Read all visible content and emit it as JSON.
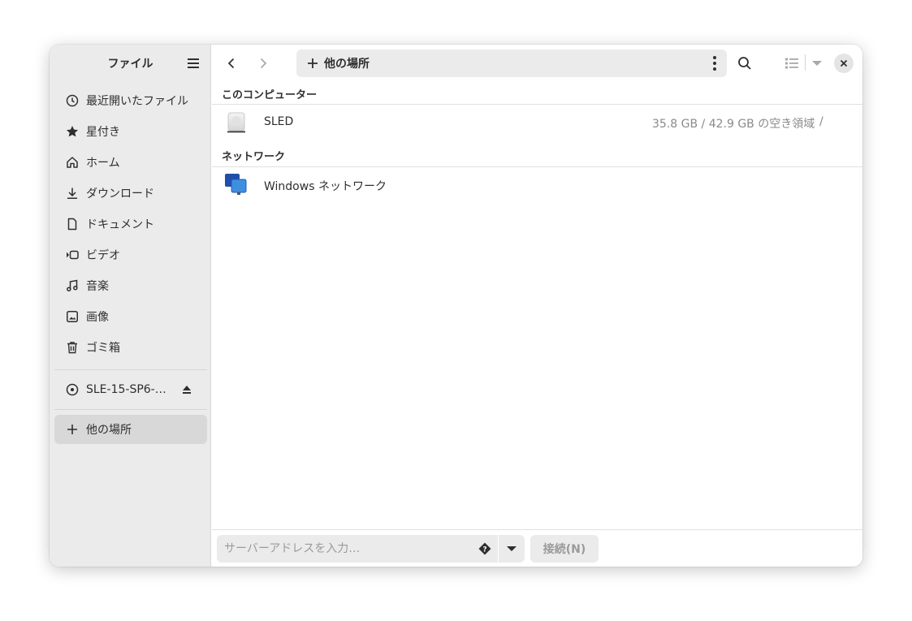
{
  "sidebar": {
    "title": "ファイル",
    "items": [
      {
        "label": "最近開いたファイル",
        "icon": "clock-icon"
      },
      {
        "label": "星付き",
        "icon": "star-icon"
      },
      {
        "label": "ホーム",
        "icon": "home-icon"
      },
      {
        "label": "ダウンロード",
        "icon": "download-icon"
      },
      {
        "label": "ドキュメント",
        "icon": "document-icon"
      },
      {
        "label": "ビデオ",
        "icon": "video-icon"
      },
      {
        "label": "音楽",
        "icon": "music-icon"
      },
      {
        "label": "画像",
        "icon": "image-icon"
      },
      {
        "label": "ゴミ箱",
        "icon": "trash-icon"
      }
    ],
    "device": {
      "label": "SLE-15-SP6-…",
      "icon": "disc-icon"
    },
    "other_locations": {
      "label": "他の場所",
      "icon": "plus-icon"
    }
  },
  "header": {
    "path_label": "他の場所"
  },
  "content": {
    "sections": [
      {
        "title": "このコンピューター",
        "rows": [
          {
            "name": "SLED",
            "info": "35.8 GB / 42.9 GB の空き領域",
            "path": "/",
            "icon": "drive-icon"
          }
        ]
      },
      {
        "title": "ネットワーク",
        "rows": [
          {
            "name": "Windows ネットワーク",
            "info": "",
            "path": "",
            "icon": "network-icon"
          }
        ]
      }
    ]
  },
  "bottom": {
    "address_placeholder": "サーバーアドレスを入力…",
    "connect_label": "接続(N)"
  },
  "colors": {
    "sidebar_bg": "#ebebeb",
    "active_item_bg": "#d8d8d8",
    "text": "#2e2e2e",
    "dim_text": "#8a8a8a"
  }
}
